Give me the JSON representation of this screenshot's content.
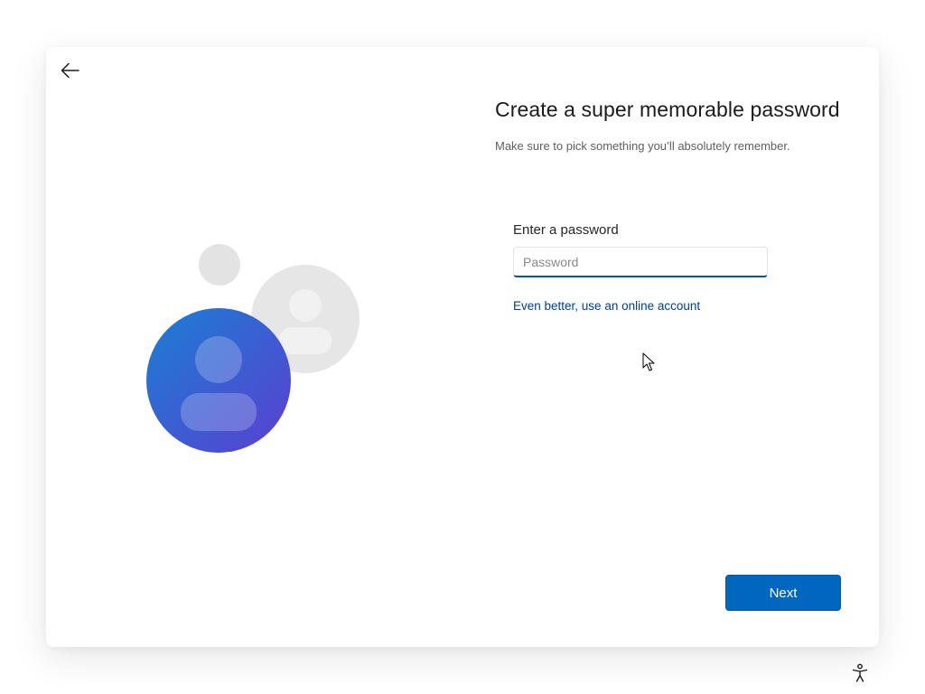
{
  "header": {
    "back_icon": "arrow-left-icon"
  },
  "illustration": {
    "icon": "user-accounts-illustration",
    "colors": {
      "primary_gradient_start": "#1a7fd4",
      "primary_gradient_end": "#5b3fd0",
      "secondary": "#e6e6e6"
    }
  },
  "main": {
    "title": "Create a super memorable password",
    "subtitle": "Make sure to pick something you’ll absolutely remember.",
    "password_field": {
      "label": "Enter a password",
      "placeholder": "Password",
      "value": ""
    },
    "online_account_link": "Even better, use an online account"
  },
  "footer": {
    "next_label": "Next",
    "accessibility_icon": "accessibility-icon"
  },
  "colors": {
    "accent": "#0067c0",
    "link": "#003e92",
    "input_underline": "#005a9e"
  }
}
